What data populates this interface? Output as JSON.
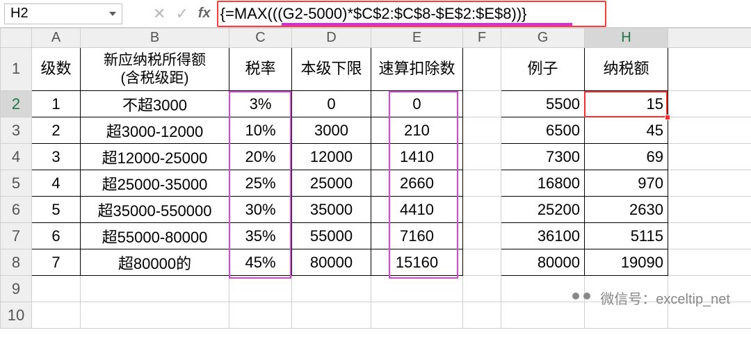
{
  "namebox": {
    "value": "H2"
  },
  "formula_bar": {
    "fx_label": "fx",
    "formula": "{=MAX(((G2-5000)*$C$2:$C$8-$E$2:$E$8))}"
  },
  "columns": [
    "A",
    "B",
    "C",
    "D",
    "E",
    "F",
    "G",
    "H"
  ],
  "row_numbers": [
    1,
    2,
    3,
    4,
    5,
    6,
    7,
    8,
    9,
    10
  ],
  "header_row": {
    "A": "级数",
    "B": "新应纳税所得额\n(含税级距)",
    "C": "税率",
    "D": "本级下限",
    "E": "速算扣除数",
    "G": "例子",
    "H": "纳税额"
  },
  "tax_table": [
    {
      "n": "1",
      "range": "不超3000",
      "rate": "3%",
      "base": "0",
      "deduct": "0"
    },
    {
      "n": "2",
      "range": "超3000-12000",
      "rate": "10%",
      "base": "3000",
      "deduct": "210"
    },
    {
      "n": "3",
      "range": "超12000-25000",
      "rate": "20%",
      "base": "12000",
      "deduct": "1410"
    },
    {
      "n": "4",
      "range": "超25000-35000",
      "rate": "25%",
      "base": "25000",
      "deduct": "2660"
    },
    {
      "n": "5",
      "range": "超35000-550000",
      "rate": "30%",
      "base": "35000",
      "deduct": "4410"
    },
    {
      "n": "6",
      "range": "超55000-80000",
      "rate": "35%",
      "base": "55000",
      "deduct": "7160"
    },
    {
      "n": "7",
      "range": "超80000的",
      "rate": "45%",
      "base": "80000",
      "deduct": "15160"
    }
  ],
  "example_table": [
    {
      "g": "5500",
      "h": "15"
    },
    {
      "g": "6500",
      "h": "45"
    },
    {
      "g": "7300",
      "h": "69"
    },
    {
      "g": "16800",
      "h": "970"
    },
    {
      "g": "25200",
      "h": "2630"
    },
    {
      "g": "36100",
      "h": "5115"
    },
    {
      "g": "80000",
      "h": "19090"
    }
  ],
  "active_cell": "H2",
  "watermark": {
    "text": "微信号：exceltip_net"
  },
  "chart_data": {
    "type": "table",
    "title": "个人所得税税率表与纳税额示例",
    "columns": [
      "级数",
      "新应纳税所得额(含税级距)",
      "税率",
      "本级下限",
      "速算扣除数",
      "例子",
      "纳税额"
    ],
    "rows": [
      [
        "1",
        "不超3000",
        "3%",
        "0",
        "0",
        "5500",
        "15"
      ],
      [
        "2",
        "超3000-12000",
        "10%",
        "3000",
        "210",
        "6500",
        "45"
      ],
      [
        "3",
        "超12000-25000",
        "20%",
        "12000",
        "1410",
        "7300",
        "69"
      ],
      [
        "4",
        "超25000-35000",
        "25%",
        "25000",
        "2660",
        "16800",
        "970"
      ],
      [
        "5",
        "超35000-550000",
        "30%",
        "35000",
        "4410",
        "25200",
        "2630"
      ],
      [
        "6",
        "超55000-80000",
        "35%",
        "55000",
        "7160",
        "36100",
        "5115"
      ],
      [
        "7",
        "超80000的",
        "45%",
        "80000",
        "15160",
        "80000",
        "19090"
      ]
    ],
    "formula": "{=MAX(((G2-5000)*$C$2:$C$8-$E$2:$E$8))}"
  }
}
